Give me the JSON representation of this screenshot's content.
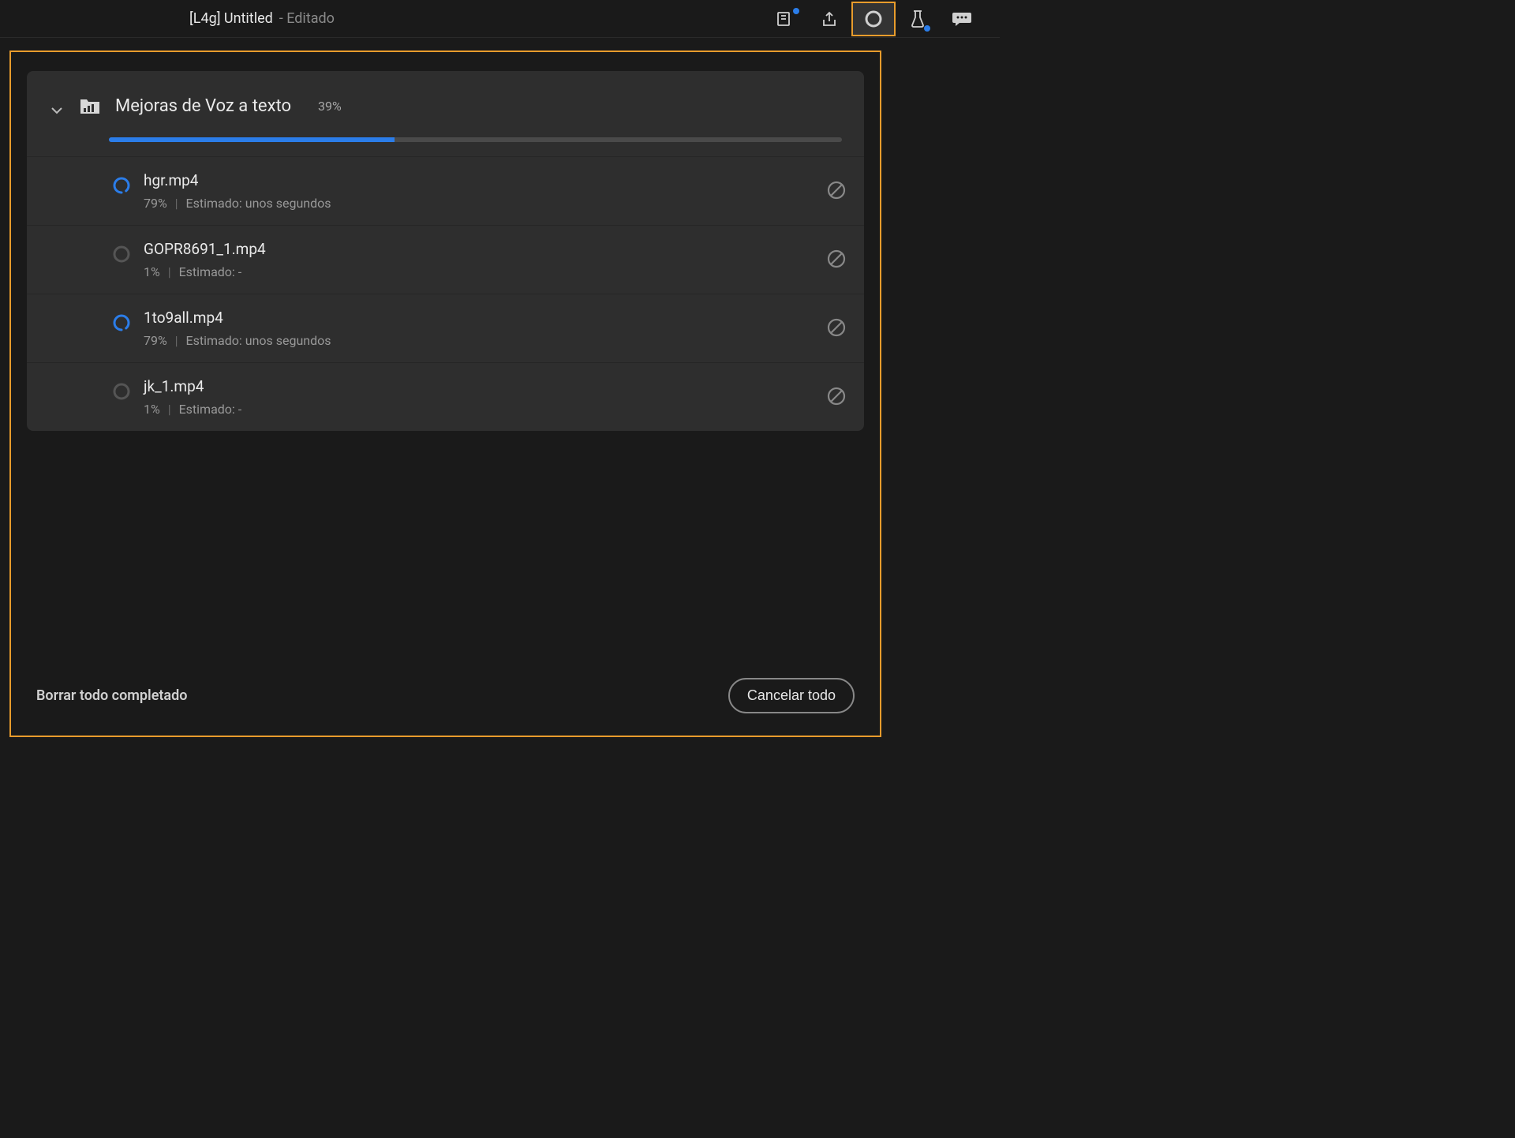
{
  "header": {
    "title_prefix": "[L4g] Untitled",
    "title_suffix": "- Editado"
  },
  "panel": {
    "group_title": "Mejoras de Voz a texto",
    "group_percent": "39%",
    "progress_pct": 39,
    "items": [
      {
        "name": "hgr.mp4",
        "percent": "79%",
        "estimate_label": "Estimado:",
        "estimate_value": "unos segundos",
        "active": true
      },
      {
        "name": "GOPR8691_1.mp4",
        "percent": "1%",
        "estimate_label": "Estimado:",
        "estimate_value": "-",
        "active": false
      },
      {
        "name": "1to9all.mp4",
        "percent": "79%",
        "estimate_label": "Estimado:",
        "estimate_value": "unos segundos",
        "active": true
      },
      {
        "name": "jk_1.mp4",
        "percent": "1%",
        "estimate_label": "Estimado:",
        "estimate_value": "-",
        "active": false
      }
    ]
  },
  "footer": {
    "clear_label": "Borrar todo completado",
    "cancel_all_label": "Cancelar todo"
  }
}
